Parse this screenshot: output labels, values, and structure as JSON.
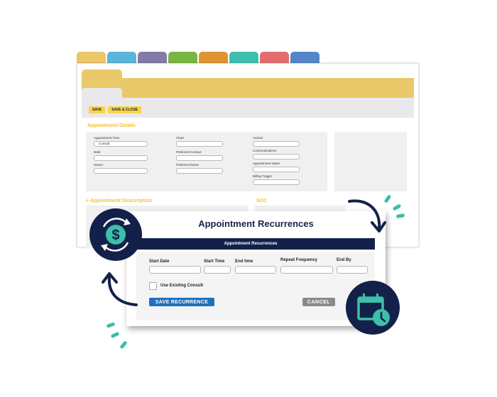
{
  "app": {
    "module_tabs": [
      {
        "color": "#ebc66a"
      },
      {
        "color": "#5bb4d9"
      },
      {
        "color": "#837aa6"
      },
      {
        "color": "#79b543"
      },
      {
        "color": "#df9432"
      },
      {
        "color": "#3fbfae"
      },
      {
        "color": "#e36c71"
      },
      {
        "color": "#5486c8"
      }
    ],
    "toolbar": {
      "save_label": "SAVE",
      "save_close_label": "SAVE & CLOSE"
    },
    "appointment_details": {
      "title": "Appointment Details",
      "fields": [
        {
          "label": "Appointment Time",
          "value": "Consult"
        },
        {
          "label": "Date",
          "value": ""
        },
        {
          "label": "Owner",
          "value": ""
        },
        {
          "label": "Chart",
          "value": ""
        },
        {
          "label": "Preferred Contact",
          "value": ""
        },
        {
          "label": "Preferred Name",
          "value": ""
        },
        {
          "label": "Animal",
          "value": ""
        },
        {
          "label": "Communications",
          "value": ""
        },
        {
          "label": "Appointment status",
          "value": ""
        },
        {
          "label": "Billing Trigger",
          "value": ""
        }
      ]
    },
    "appointment_description": {
      "title": "+ Appointment Desceription"
    },
    "soc": {
      "title": "SOC"
    }
  },
  "dialog": {
    "title": "Appointment Recurrences",
    "band_title": "Appointment Recurrences",
    "fields": [
      {
        "label": "Start Date",
        "value": ""
      },
      {
        "label": "Start Time",
        "value": ""
      },
      {
        "label": "End time",
        "value": ""
      },
      {
        "label": "Repeat Frequency",
        "value": ""
      },
      {
        "label": "End By",
        "value": ""
      }
    ],
    "checkbox": {
      "label": "Use Existing Consult",
      "checked": false
    },
    "save_label": "SAVE RECURRENCE",
    "cancel_label": "CANCEL"
  },
  "badges": {
    "billing": {
      "icon": "dollar-refresh-icon"
    },
    "schedule": {
      "icon": "calendar-clock-icon"
    }
  },
  "colors": {
    "accent_yellow": "#eac96b",
    "navy": "#13214a",
    "teal": "#3dbfa8",
    "save_blue": "#1f70bd",
    "cancel_grey": "#8a8a8a"
  }
}
